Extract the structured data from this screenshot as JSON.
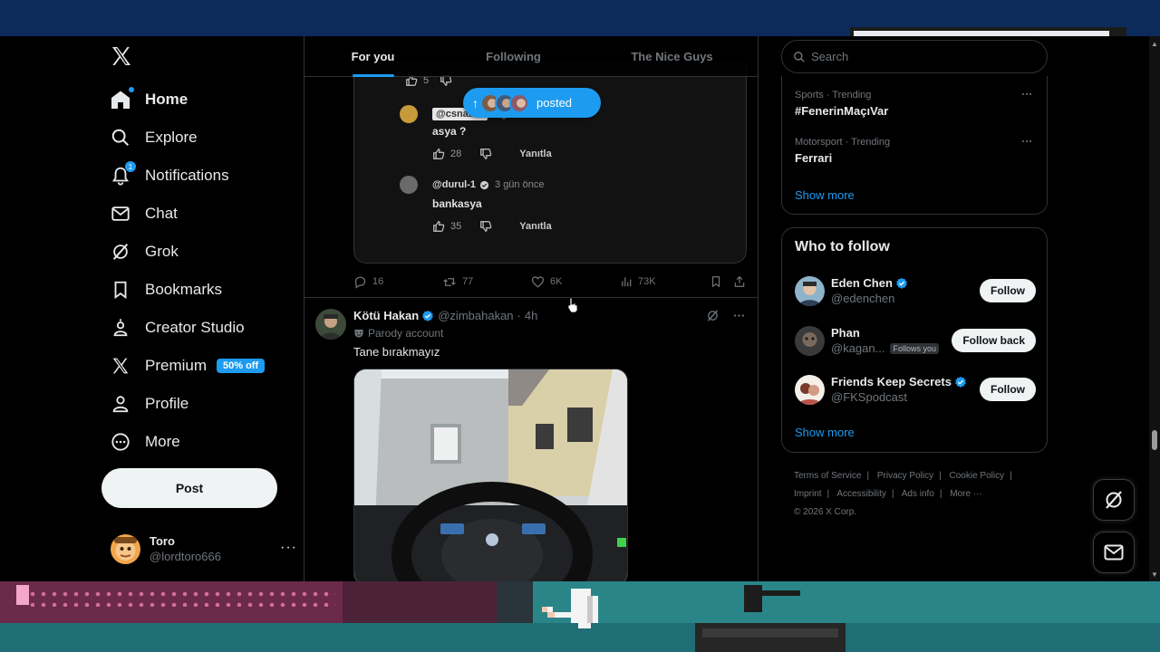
{
  "nav": {
    "items": [
      {
        "label": "Home",
        "icon": "home-icon"
      },
      {
        "label": "Explore",
        "icon": "search-icon"
      },
      {
        "label": "Notifications",
        "icon": "bell-icon",
        "badge": "1"
      },
      {
        "label": "Chat",
        "icon": "mail-icon"
      },
      {
        "label": "Grok",
        "icon": "grok-icon"
      },
      {
        "label": "Bookmarks",
        "icon": "bookmark-icon"
      },
      {
        "label": "Creator Studio",
        "icon": "creator-icon"
      },
      {
        "label": "Premium",
        "icon": "x-logo-icon",
        "badge": "50% off"
      },
      {
        "label": "Profile",
        "icon": "person-icon"
      },
      {
        "label": "More",
        "icon": "more-circle-icon"
      }
    ],
    "post_label": "Post",
    "account": {
      "name": "Toro",
      "handle": "@lordtoro666",
      "more": "···"
    }
  },
  "tabs": [
    "For you",
    "Following",
    "The Nice Guys"
  ],
  "posted_pill": {
    "label": "posted"
  },
  "quoted_media": {
    "top_like_count": "5",
    "comments": [
      {
        "handle": "@csnaber",
        "time": "3 gün önce",
        "text": "asya ?",
        "likes": "28",
        "reply": "Yanıtla"
      },
      {
        "handle": "@durul-1",
        "time": "3 gün önce",
        "text": "bankasya",
        "likes": "35",
        "reply": "Yanıtla"
      }
    ]
  },
  "post1_actions": {
    "replies": "16",
    "reposts": "77",
    "likes": "6K",
    "views": "73K"
  },
  "post2": {
    "name": "Kötü Hakan",
    "handle": "@zimbahakan",
    "sep": "·",
    "time": "4h",
    "parody": "Parody account",
    "text": "Tane bırakmayız"
  },
  "search": {
    "placeholder": "Search"
  },
  "trends": [
    {
      "meta": "Sports · Trending",
      "title": "#FenerinMaçıVar"
    },
    {
      "meta": "Motorsport · Trending",
      "title": "Ferrari"
    }
  ],
  "trends_show_more": "Show more",
  "who_to_follow": {
    "title": "Who to follow",
    "users": [
      {
        "name": "Eden Chen",
        "handle": "@edenchen",
        "verified": true,
        "button": "Follow"
      },
      {
        "name": "Phan",
        "handle": "@kagan...",
        "follows_you": "Follows you",
        "button": "Follow back"
      },
      {
        "name": "Friends Keep Secrets",
        "handle": "@FKSpodcast",
        "verified": true,
        "button": "Follow"
      }
    ],
    "show_more": "Show more"
  },
  "footer": {
    "links": [
      "Terms of Service",
      "Privacy Policy",
      "Cookie Policy",
      "Imprint",
      "Accessibility",
      "Ads info",
      "More ···"
    ],
    "copyright": "© 2026 X Corp."
  },
  "colors": {
    "accent": "#1d9bf0",
    "background": "#000000",
    "border": "#2f3336",
    "muted": "#71767b"
  }
}
